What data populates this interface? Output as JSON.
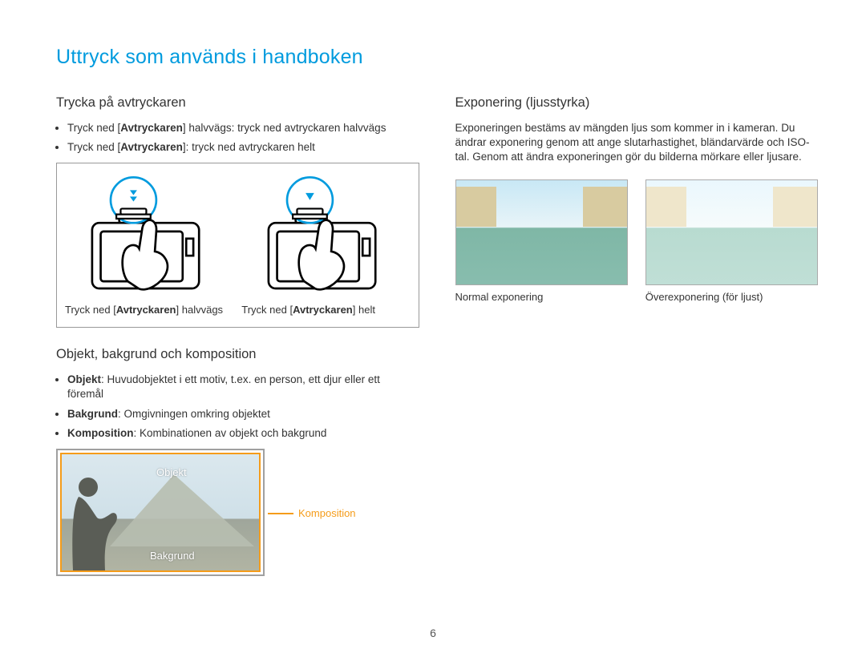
{
  "title": "Uttryck som används i handboken",
  "left": {
    "shutter": {
      "heading": "Trycka på avtryckaren",
      "bullets": [
        {
          "pre": "Tryck ned [",
          "bold": "Avtryckaren",
          "post": "] halvvägs: tryck ned avtryckaren halvvägs"
        },
        {
          "pre": "Tryck ned [",
          "bold": "Avtryckaren",
          "post": "]: tryck ned avtryckaren helt"
        }
      ],
      "cap1": {
        "pre": "Tryck ned [",
        "bold": "Avtryckaren",
        "post": "] halvvägs"
      },
      "cap2": {
        "pre": "Tryck ned [",
        "bold": "Avtryckaren",
        "post": "] helt"
      }
    },
    "obj": {
      "heading": "Objekt, bakgrund och komposition",
      "bullets": [
        {
          "bold": "Objekt",
          "rest": ": Huvudobjektet i ett motiv, t.ex. en person, ett djur eller ett föremål"
        },
        {
          "bold": "Bakgrund",
          "rest": ": Omgivningen omkring objektet"
        },
        {
          "bold": "Komposition",
          "rest": ": Kombinationen av objekt och bakgrund"
        }
      ],
      "labels": {
        "objekt": "Objekt",
        "bakgrund": "Bakgrund",
        "komposition": "Komposition"
      }
    }
  },
  "right": {
    "exposure": {
      "heading": "Exponering (ljusstyrka)",
      "para": "Exponeringen bestäms av mängden ljus som kommer in i kameran. Du ändrar exponering genom att ange slutarhastighet, bländarvärde och ISO-tal. Genom att ändra exponeringen gör du bilderna mörkare eller ljusare.",
      "cap1": "Normal exponering",
      "cap2": "Överexponering (för ljust)"
    }
  },
  "pageNumber": "6"
}
